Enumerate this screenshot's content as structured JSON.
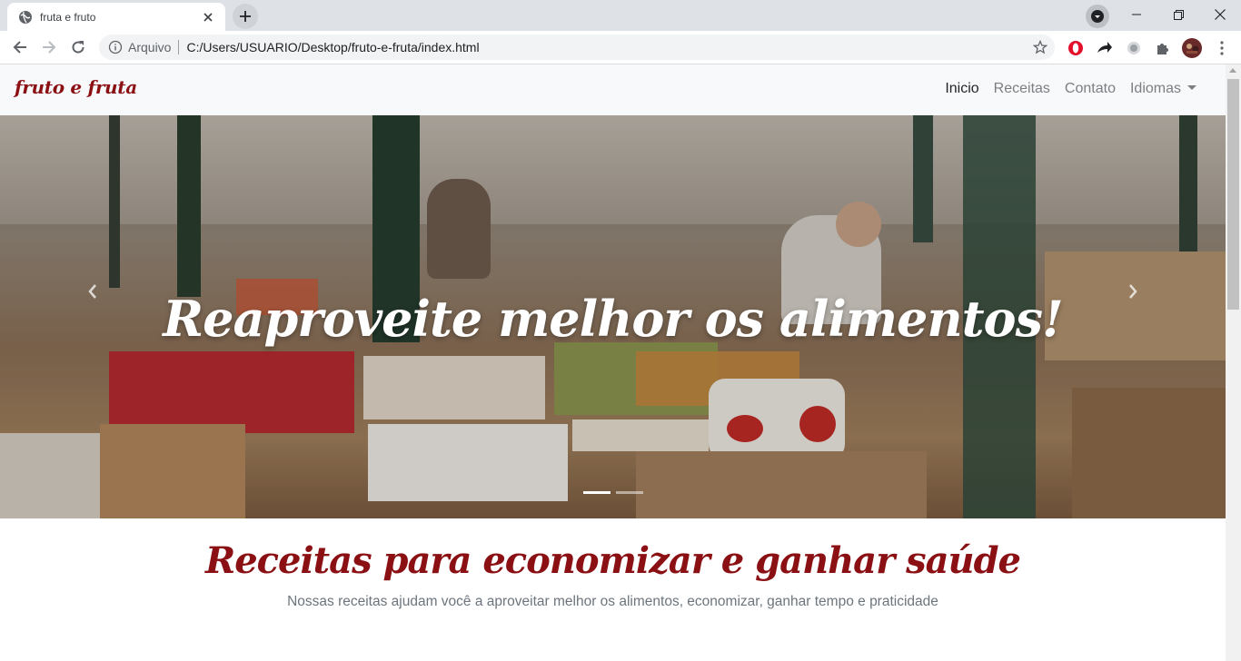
{
  "browser": {
    "tab_title": "fruta e fruto",
    "address_scheme": "Arquivo",
    "address_url": "C:/Users/USUARIO/Desktop/fruto-e-fruta/index.html"
  },
  "site": {
    "brand": "fruto e fruta",
    "nav": {
      "inicio": "Inicio",
      "receitas": "Receitas",
      "contato": "Contato",
      "idiomas": "Idiomas"
    },
    "carousel": {
      "caption": "Reaproveite melhor os alimentos!",
      "slide_count": 2,
      "active_slide": 1
    },
    "section": {
      "title": "Receitas para economizar e ganhar saúde",
      "subtitle": "Nossas receitas ajudam você a aproveitar melhor os alimentos, economizar, ganhar tempo e praticidade"
    }
  },
  "colors": {
    "brand": "#8b1014",
    "nav_active": "#212529",
    "nav_muted": "#7b7f83"
  }
}
